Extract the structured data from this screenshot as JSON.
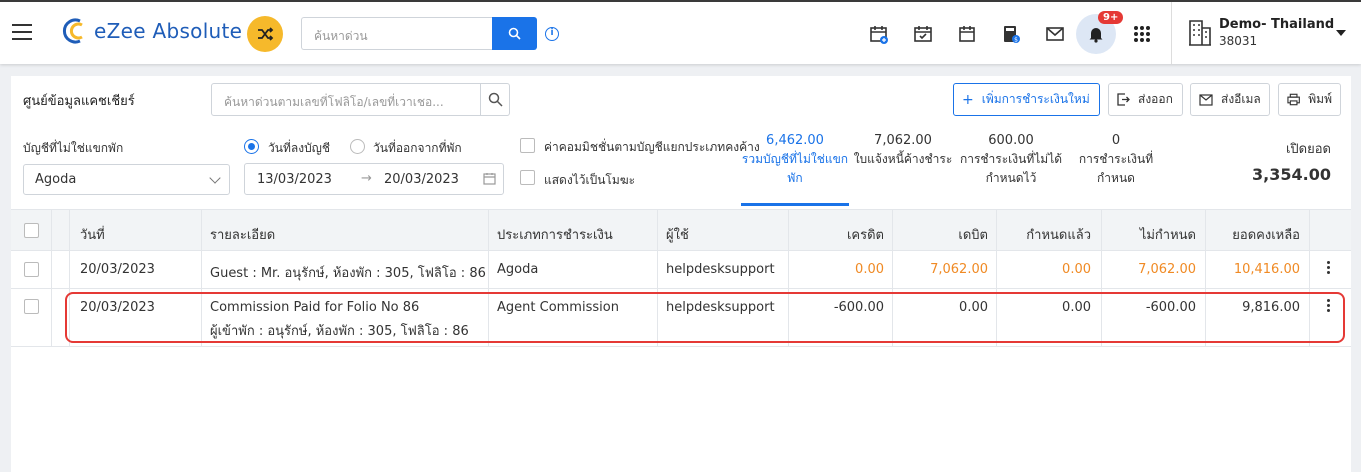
{
  "app": {
    "name": "eZee Absolute"
  },
  "header": {
    "search_placeholder": "ค้นหาด่วน",
    "notification_badge": "9+",
    "property_name": "Demo- Thailand",
    "property_code": "38031"
  },
  "page": {
    "title": "ศูนย์ข้อมูลแคชเชียร์",
    "search_placeholder": "ค้นหาด่วนตามเลขที่โฟลิโอ/เลขที่เวาเชอ...",
    "buttons": {
      "add_payment": "เพิ่มการชำระเงินใหม่",
      "export": "ส่งออก",
      "email": "ส่งอีเมล",
      "print": "พิมพ์"
    }
  },
  "filters": {
    "account_label": "บัญชีที่ไม่ใช่แขกพัก",
    "account_value": "Agoda",
    "radio_posting_date": "วันที่ลงบัญชี",
    "radio_checkout_date": "วันที่ออกจากที่พัก",
    "date_from": "13/03/2023",
    "date_to": "20/03/2023",
    "check_commission": "ค่าคอมมิชชั่นตามบัญชีแยกประเภทคงค้าง",
    "check_void": "แสดงไว้เป็นโมฆะ"
  },
  "stats": [
    {
      "value": "6,462.00",
      "label1": "รวมบัญชีที่ไม่ใช่แขก",
      "label2": "พัก"
    },
    {
      "value": "7,062.00",
      "label1": "ใบแจ้งหนี้ค้างชำระ",
      "label2": ""
    },
    {
      "value": "600.00",
      "label1": "การชำระเงินที่ไม่ได้",
      "label2": "กำหนดไว้"
    },
    {
      "value": "0",
      "label1": "การชำระเงินที่กำหนด",
      "label2": ""
    }
  ],
  "opening_balance": {
    "label": "เปิดยอด",
    "value": "3,354.00"
  },
  "table": {
    "columns": [
      "วันที่",
      "รายละเอียด",
      "ประเภทการชำระเงิน",
      "ผู้ใช้",
      "เครดิต",
      "เดบิต",
      "กำหนดแล้ว",
      "ไม่กำหนด",
      "ยอดคงเหลือ"
    ],
    "rows": [
      {
        "date": "20/03/2023",
        "detail1": "Guest : Mr. อนุรักษ์, ห้องพัก : 305, โฟลิโอ : 86",
        "detail2": "",
        "payment_type": "Agoda",
        "user": "helpdesksupport",
        "credit": "0.00",
        "debit": "7,062.00",
        "assigned": "0.00",
        "unassigned": "7,062.00",
        "balance": "10,416.00"
      },
      {
        "date": "20/03/2023",
        "detail1": "Commission Paid for Folio No 86",
        "detail2": "ผู้เข้าพัก : อนุรักษ์, ห้องพัก : 305, โฟลิโอ : 86",
        "payment_type": "Agent Commission",
        "user": "helpdesksupport",
        "credit": "-600.00",
        "debit": "0.00",
        "assigned": "0.00",
        "unassigned": "-600.00",
        "balance": "9,816.00"
      }
    ]
  },
  "colors": {
    "accent": "#1a73e8",
    "highlight": "#e53935",
    "orange": "#f08a24",
    "shuffle": "#f6b92b"
  }
}
